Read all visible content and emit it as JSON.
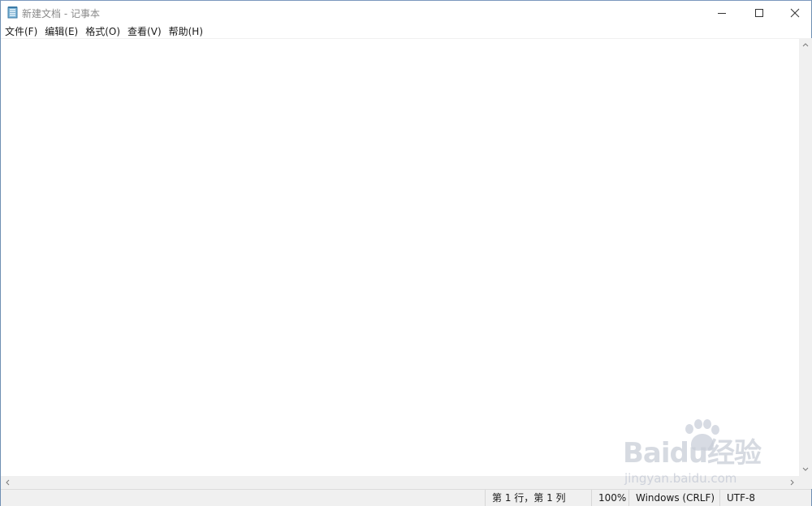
{
  "window": {
    "title": "新建文档 - 记事本",
    "icons": {
      "app": "notepad-icon",
      "minimize": "minimize-icon",
      "maximize": "maximize-icon",
      "close": "close-icon"
    }
  },
  "menu": {
    "items": [
      {
        "label": "文件(F)"
      },
      {
        "label": "编辑(E)"
      },
      {
        "label": "格式(O)"
      },
      {
        "label": "查看(V)"
      },
      {
        "label": "帮助(H)"
      }
    ]
  },
  "editor": {
    "content": ""
  },
  "statusbar": {
    "position": "第 1 行，第 1 列",
    "zoom": "100%",
    "line_ending": "Windows (CRLF)",
    "encoding": "UTF-8"
  },
  "watermark": {
    "logo": "Baidu经验",
    "url": "jingyan.baidu.com"
  },
  "colors": {
    "window_border": "#6f8fb3",
    "statusbar_bg": "#f0f0f0",
    "scrollbar_bg": "#f0f0f0"
  }
}
